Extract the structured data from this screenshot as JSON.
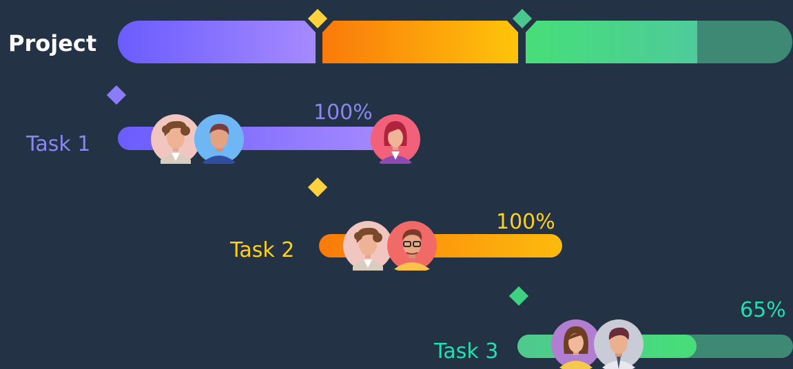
{
  "chart_data": {
    "type": "gantt",
    "project": {
      "label": "Project",
      "label_color": "#FFFFFF"
    },
    "tasks": [
      {
        "name": "Task 1",
        "percent": "100%",
        "progress": 1.0,
        "label_color": "#8B86F0",
        "percent_color": "#8B86F0",
        "color_start": "#6A5CFF",
        "color_end": "#A58AFE",
        "track_color": "#A58AFE",
        "milestone_color": "#8A7CF6",
        "assignees": [
          "avatar-curly-hair-woman",
          "avatar-man-blue-shirt",
          "avatar-woman-red-hair"
        ]
      },
      {
        "name": "Task 2",
        "percent": "100%",
        "progress": 1.0,
        "label_color": "#FFD21A",
        "percent_color": "#FFD21A",
        "color_start": "#FA7A0A",
        "color_end": "#FDBB0C",
        "track_color": "#FDBB0C",
        "milestone_color": "#FED23E",
        "assignees": [
          "avatar-curly-hair-woman",
          "avatar-man-glasses"
        ]
      },
      {
        "name": "Task 3",
        "percent": "65%",
        "progress": 0.65,
        "label_color": "#20E0B5",
        "percent_color": "#20E0B5",
        "color_start": "#4EC98E",
        "color_end": "#47DE79",
        "track_color": "#3E8974",
        "milestone_color": "#3FD082",
        "assignees": [
          "avatar-woman-brown-hair",
          "avatar-man-tie"
        ]
      }
    ],
    "project_milestone_colors": [
      "#FED23E",
      "#4BC78D"
    ]
  }
}
